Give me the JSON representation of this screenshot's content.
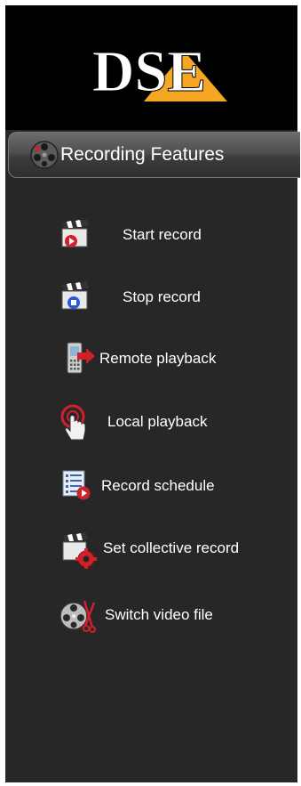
{
  "logo": {
    "text": "DSE",
    "accent_color": "#f5a623"
  },
  "header": {
    "title": "Recording Features",
    "icon": "film-reel-icon"
  },
  "menu": {
    "items": [
      {
        "label": "Start record",
        "icon": "clapperboard-play-icon"
      },
      {
        "label": "Stop record",
        "icon": "clapperboard-stop-icon"
      },
      {
        "label": "Remote playback",
        "icon": "phone-playback-icon"
      },
      {
        "label": "Local playback",
        "icon": "hand-touch-icon"
      },
      {
        "label": "Record schedule",
        "icon": "schedule-list-icon"
      },
      {
        "label": "Set collective record",
        "icon": "clapperboard-gear-icon"
      },
      {
        "label": "Switch video file",
        "icon": "film-reel-scissors-icon"
      }
    ]
  },
  "colors": {
    "panel": "#272727",
    "text": "#ffffff",
    "accent_red": "#d0202a",
    "accent_blue": "#2a5bd7"
  }
}
